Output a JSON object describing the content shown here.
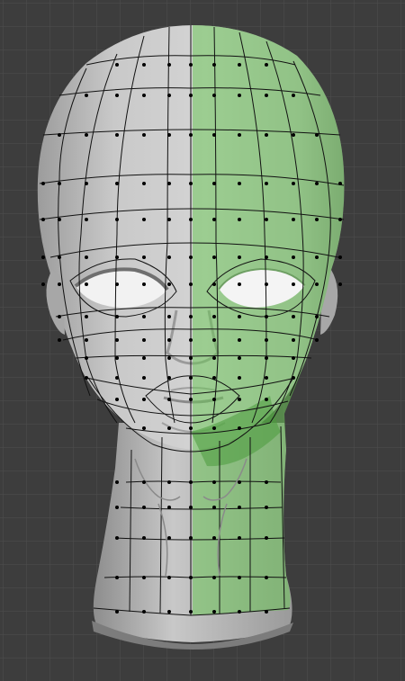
{
  "viewport": {
    "background_color": "#3d3d3d",
    "grid_color": "#4f4f4f",
    "model": "head-retopology",
    "mesh_color": "#c6c6c6",
    "selection_color": "#6dc65a",
    "wire_color": "#111111",
    "vertex_color": "#000000"
  }
}
